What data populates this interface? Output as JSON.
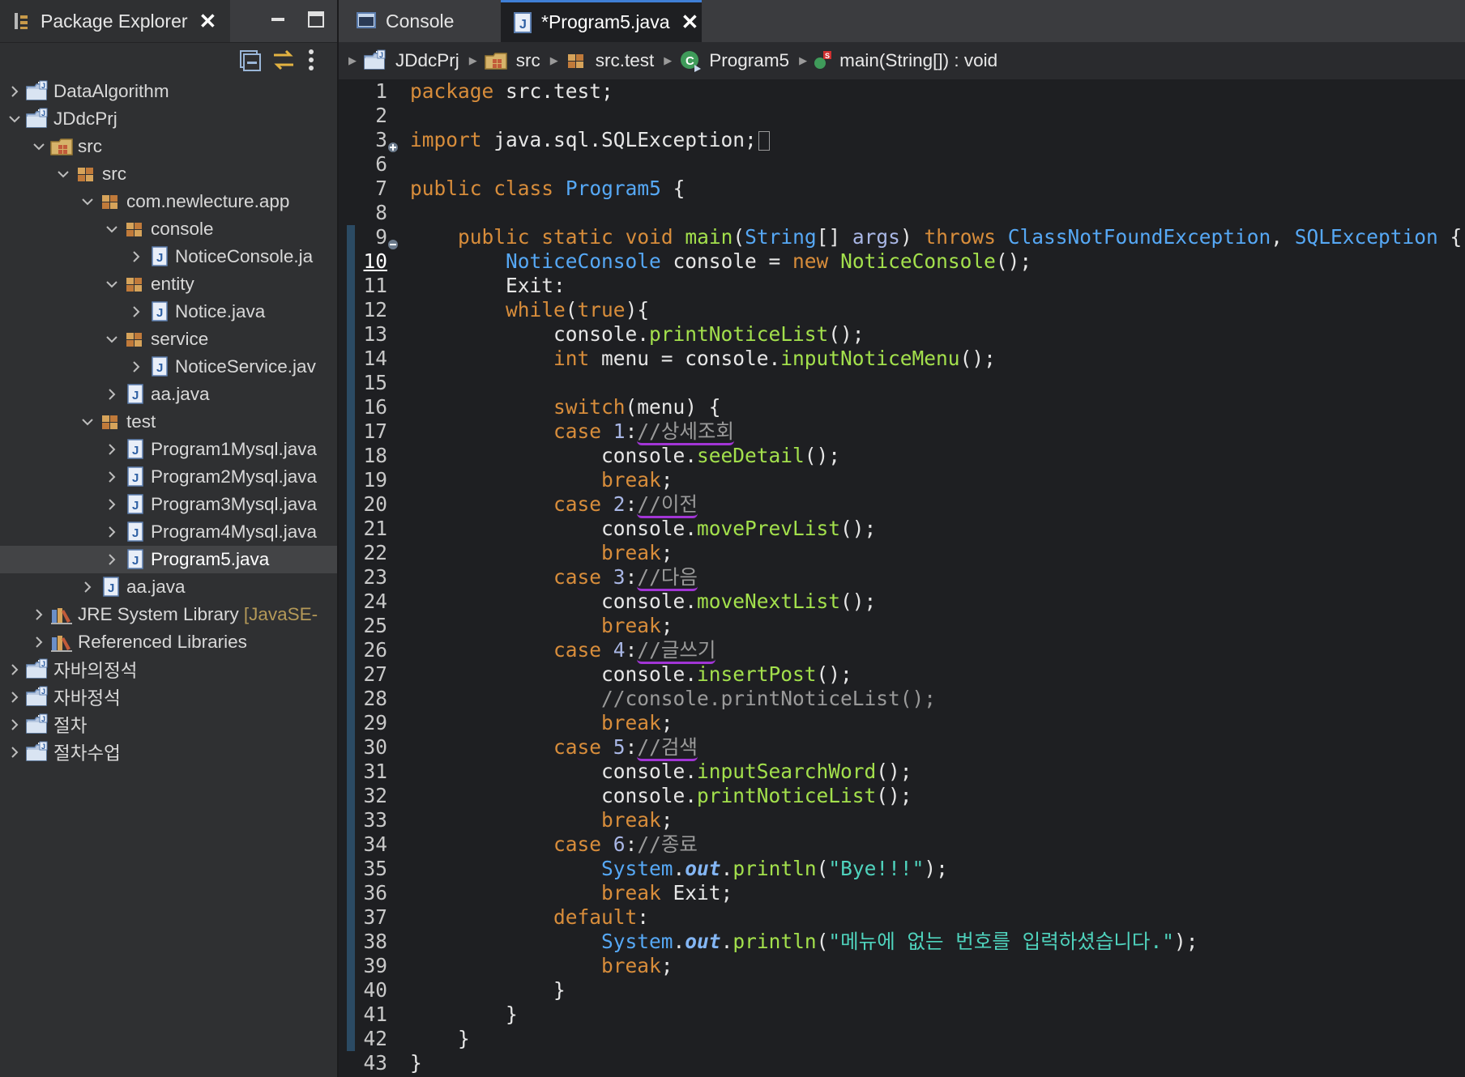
{
  "package_explorer": {
    "title": "Package Explorer",
    "tree": [
      {
        "label": "DataAlgorithm",
        "icon": "project-icon",
        "depth": 0,
        "expanded": false
      },
      {
        "label": "JDdcPrj",
        "icon": "project-icon",
        "depth": 0,
        "expanded": true
      },
      {
        "label": "src",
        "icon": "source-folder-icon",
        "depth": 1,
        "expanded": true
      },
      {
        "label": "src",
        "icon": "package-icon",
        "depth": 2,
        "expanded": true
      },
      {
        "label": "com.newlecture.app",
        "icon": "package-icon",
        "depth": 3,
        "expanded": true
      },
      {
        "label": "console",
        "icon": "package-icon",
        "depth": 4,
        "expanded": true
      },
      {
        "label": "NoticeConsole.ja",
        "icon": "java-file-icon",
        "depth": 5,
        "expanded": false
      },
      {
        "label": "entity",
        "icon": "package-icon",
        "depth": 4,
        "expanded": true
      },
      {
        "label": "Notice.java",
        "icon": "java-file-icon",
        "depth": 5,
        "expanded": false
      },
      {
        "label": "service",
        "icon": "package-icon",
        "depth": 4,
        "expanded": true
      },
      {
        "label": "NoticeService.jav",
        "icon": "java-file-icon",
        "depth": 5,
        "expanded": false
      },
      {
        "label": "aa.java",
        "icon": "java-file-icon",
        "depth": 4,
        "expanded": false
      },
      {
        "label": "test",
        "icon": "package-icon",
        "depth": 3,
        "expanded": true
      },
      {
        "label": "Program1Mysql.java",
        "icon": "java-file-icon",
        "depth": 4,
        "expanded": false
      },
      {
        "label": "Program2Mysql.java",
        "icon": "java-file-icon",
        "depth": 4,
        "expanded": false
      },
      {
        "label": "Program3Mysql.java",
        "icon": "java-file-icon",
        "depth": 4,
        "expanded": false
      },
      {
        "label": "Program4Mysql.java",
        "icon": "java-file-icon",
        "depth": 4,
        "expanded": false
      },
      {
        "label": "Program5.java",
        "icon": "java-file-icon",
        "depth": 4,
        "expanded": false,
        "selected": true
      },
      {
        "label": "aa.java",
        "icon": "java-file-icon",
        "depth": 3,
        "expanded": false
      },
      {
        "label": "JRE System Library",
        "suffix": "[JavaSE-",
        "icon": "library-icon",
        "depth": 1,
        "expanded": false
      },
      {
        "label": "Referenced Libraries",
        "icon": "library-icon",
        "depth": 1,
        "expanded": false
      },
      {
        "label": "자바의정석",
        "icon": "project-icon",
        "depth": 0,
        "expanded": false
      },
      {
        "label": "자바정석",
        "icon": "project-icon",
        "depth": 0,
        "expanded": false
      },
      {
        "label": "절차",
        "icon": "project-icon",
        "depth": 0,
        "expanded": false
      },
      {
        "label": "절차수업",
        "icon": "project-icon",
        "depth": 0,
        "expanded": false
      }
    ]
  },
  "editor": {
    "tabs": [
      {
        "label": "Console",
        "active": false
      },
      {
        "label": "*Program5.java",
        "active": true
      }
    ],
    "breadcrumb": [
      {
        "label": "JDdcPrj",
        "icon": "project-icon"
      },
      {
        "label": "src",
        "icon": "source-folder-icon"
      },
      {
        "label": "src.test",
        "icon": "package-icon"
      },
      {
        "label": "Program5",
        "icon": "class-icon"
      },
      {
        "label": "main(String[]) : void",
        "icon": "method-icon"
      }
    ],
    "current_line": "10",
    "code": [
      {
        "n": "1",
        "t": [
          [
            "package",
            "kw"
          ],
          [
            " src.test;",
            ""
          ]
        ]
      },
      {
        "n": "2",
        "t": []
      },
      {
        "n": "3",
        "fold": "expand",
        "t": [
          [
            "import",
            "kw"
          ],
          [
            " java.sql.SQLException;",
            ""
          ]
        ],
        "folded_marker": true
      },
      {
        "n": "6",
        "t": []
      },
      {
        "n": "7",
        "t": [
          [
            "public",
            "kw"
          ],
          [
            " ",
            ""
          ],
          [
            "class",
            "kw"
          ],
          [
            " ",
            ""
          ],
          [
            "Program5",
            "ty"
          ],
          [
            " {",
            ""
          ]
        ]
      },
      {
        "n": "8",
        "t": []
      },
      {
        "n": "9",
        "fold": "collapse",
        "t": [
          [
            "    ",
            ""
          ],
          [
            "public",
            "kw"
          ],
          [
            " ",
            ""
          ],
          [
            "static",
            "kw"
          ],
          [
            " ",
            ""
          ],
          [
            "void",
            "kw"
          ],
          [
            " ",
            ""
          ],
          [
            "main",
            "mt"
          ],
          [
            "(",
            ""
          ],
          [
            "String",
            "ty"
          ],
          [
            "[] ",
            ""
          ],
          [
            "args",
            "pm"
          ],
          [
            ") ",
            ""
          ],
          [
            "throws",
            "kw"
          ],
          [
            " ",
            ""
          ],
          [
            "ClassNotFoundException",
            "ty"
          ],
          [
            ", ",
            ""
          ],
          [
            "SQLException",
            "ty"
          ],
          [
            " {",
            ""
          ]
        ]
      },
      {
        "n": "10",
        "t": [
          [
            "        ",
            ""
          ],
          [
            "NoticeConsole",
            "ty"
          ],
          [
            " console = ",
            ""
          ],
          [
            "new",
            "kw"
          ],
          [
            " ",
            ""
          ],
          [
            "NoticeConsole",
            "mt"
          ],
          [
            "();",
            ""
          ]
        ]
      },
      {
        "n": "11",
        "t": [
          [
            "        Exit:",
            ""
          ]
        ]
      },
      {
        "n": "12",
        "t": [
          [
            "        ",
            ""
          ],
          [
            "while",
            "kw"
          ],
          [
            "(",
            ""
          ],
          [
            "true",
            "kw"
          ],
          [
            "){",
            ""
          ]
        ]
      },
      {
        "n": "13",
        "t": [
          [
            "            console.",
            ""
          ],
          [
            "printNoticeList",
            "mt"
          ],
          [
            "();",
            ""
          ]
        ]
      },
      {
        "n": "14",
        "t": [
          [
            "            ",
            ""
          ],
          [
            "int",
            "kw"
          ],
          [
            " menu = console.",
            ""
          ],
          [
            "inputNoticeMenu",
            "mt"
          ],
          [
            "();",
            ""
          ]
        ]
      },
      {
        "n": "15",
        "t": []
      },
      {
        "n": "16",
        "t": [
          [
            "            ",
            ""
          ],
          [
            "switch",
            "kw"
          ],
          [
            "(menu) {",
            ""
          ]
        ]
      },
      {
        "n": "17",
        "t": [
          [
            "            ",
            ""
          ],
          [
            "case",
            "kw"
          ],
          [
            " ",
            ""
          ],
          [
            "1",
            "pm"
          ],
          [
            ":",
            ""
          ],
          [
            "//상세조회",
            "cm ul"
          ]
        ]
      },
      {
        "n": "18",
        "t": [
          [
            "                console.",
            ""
          ],
          [
            "seeDetail",
            "mt"
          ],
          [
            "();",
            ""
          ]
        ]
      },
      {
        "n": "19",
        "t": [
          [
            "                ",
            ""
          ],
          [
            "break",
            "kw"
          ],
          [
            ";",
            ""
          ]
        ]
      },
      {
        "n": "20",
        "t": [
          [
            "            ",
            ""
          ],
          [
            "case",
            "kw"
          ],
          [
            " ",
            ""
          ],
          [
            "2",
            "pm"
          ],
          [
            ":",
            ""
          ],
          [
            "//이전",
            "cm ul"
          ]
        ]
      },
      {
        "n": "21",
        "t": [
          [
            "                console.",
            ""
          ],
          [
            "movePrevList",
            "mt"
          ],
          [
            "();",
            ""
          ]
        ]
      },
      {
        "n": "22",
        "t": [
          [
            "                ",
            ""
          ],
          [
            "break",
            "kw"
          ],
          [
            ";",
            ""
          ]
        ]
      },
      {
        "n": "23",
        "t": [
          [
            "            ",
            ""
          ],
          [
            "case",
            "kw"
          ],
          [
            " ",
            ""
          ],
          [
            "3",
            "pm"
          ],
          [
            ":",
            ""
          ],
          [
            "//다음",
            "cm ul"
          ]
        ]
      },
      {
        "n": "24",
        "t": [
          [
            "                console.",
            ""
          ],
          [
            "moveNextList",
            "mt"
          ],
          [
            "();",
            ""
          ]
        ]
      },
      {
        "n": "25",
        "t": [
          [
            "                ",
            ""
          ],
          [
            "break",
            "kw"
          ],
          [
            ";",
            ""
          ]
        ]
      },
      {
        "n": "26",
        "t": [
          [
            "            ",
            ""
          ],
          [
            "case",
            "kw"
          ],
          [
            " ",
            ""
          ],
          [
            "4",
            "pm"
          ],
          [
            ":",
            ""
          ],
          [
            "//글쓰기",
            "cm ul"
          ]
        ]
      },
      {
        "n": "27",
        "t": [
          [
            "                console.",
            ""
          ],
          [
            "insertPost",
            "mt"
          ],
          [
            "();",
            ""
          ]
        ]
      },
      {
        "n": "28",
        "t": [
          [
            "                ",
            ""
          ],
          [
            "//console.printNoticeList();",
            "cm"
          ]
        ]
      },
      {
        "n": "29",
        "t": [
          [
            "                ",
            ""
          ],
          [
            "break",
            "kw"
          ],
          [
            ";",
            ""
          ]
        ]
      },
      {
        "n": "30",
        "t": [
          [
            "            ",
            ""
          ],
          [
            "case",
            "kw"
          ],
          [
            " ",
            ""
          ],
          [
            "5",
            "pm"
          ],
          [
            ":",
            ""
          ],
          [
            "//검색",
            "cm ul"
          ]
        ]
      },
      {
        "n": "31",
        "t": [
          [
            "                console.",
            ""
          ],
          [
            "inputSearchWord",
            "mt"
          ],
          [
            "();",
            ""
          ]
        ]
      },
      {
        "n": "32",
        "t": [
          [
            "                console.",
            ""
          ],
          [
            "printNoticeList",
            "mt"
          ],
          [
            "();",
            ""
          ]
        ]
      },
      {
        "n": "33",
        "t": [
          [
            "                ",
            ""
          ],
          [
            "break",
            "kw"
          ],
          [
            ";",
            ""
          ]
        ]
      },
      {
        "n": "34",
        "t": [
          [
            "            ",
            ""
          ],
          [
            "case",
            "kw"
          ],
          [
            " ",
            ""
          ],
          [
            "6",
            "pm"
          ],
          [
            ":",
            ""
          ],
          [
            "//종료",
            "cm"
          ]
        ]
      },
      {
        "n": "35",
        "t": [
          [
            "                ",
            ""
          ],
          [
            "System",
            "ty"
          ],
          [
            ".",
            ""
          ],
          [
            "out",
            "fd"
          ],
          [
            ".",
            ""
          ],
          [
            "println",
            "mt"
          ],
          [
            "(",
            ""
          ],
          [
            "\"Bye!!!\"",
            "st"
          ],
          [
            ");",
            ""
          ]
        ]
      },
      {
        "n": "36",
        "t": [
          [
            "                ",
            ""
          ],
          [
            "break",
            "kw"
          ],
          [
            " Exit;",
            ""
          ]
        ]
      },
      {
        "n": "37",
        "t": [
          [
            "            ",
            ""
          ],
          [
            "default",
            "kw"
          ],
          [
            ":",
            ""
          ]
        ]
      },
      {
        "n": "38",
        "t": [
          [
            "                ",
            ""
          ],
          [
            "System",
            "ty"
          ],
          [
            ".",
            ""
          ],
          [
            "out",
            "fd"
          ],
          [
            ".",
            ""
          ],
          [
            "println",
            "mt"
          ],
          [
            "(",
            ""
          ],
          [
            "\"메뉴에 없는 번호를 입력하셨습니다.\"",
            "st"
          ],
          [
            ");",
            ""
          ]
        ]
      },
      {
        "n": "39",
        "t": [
          [
            "                ",
            ""
          ],
          [
            "break",
            "kw"
          ],
          [
            ";",
            ""
          ]
        ]
      },
      {
        "n": "40",
        "t": [
          [
            "            }",
            ""
          ]
        ]
      },
      {
        "n": "41",
        "t": [
          [
            "        }",
            ""
          ]
        ]
      },
      {
        "n": "42",
        "t": [
          [
            "    }",
            ""
          ]
        ]
      },
      {
        "n": "43",
        "t": [
          [
            "}",
            ""
          ]
        ]
      }
    ]
  }
}
